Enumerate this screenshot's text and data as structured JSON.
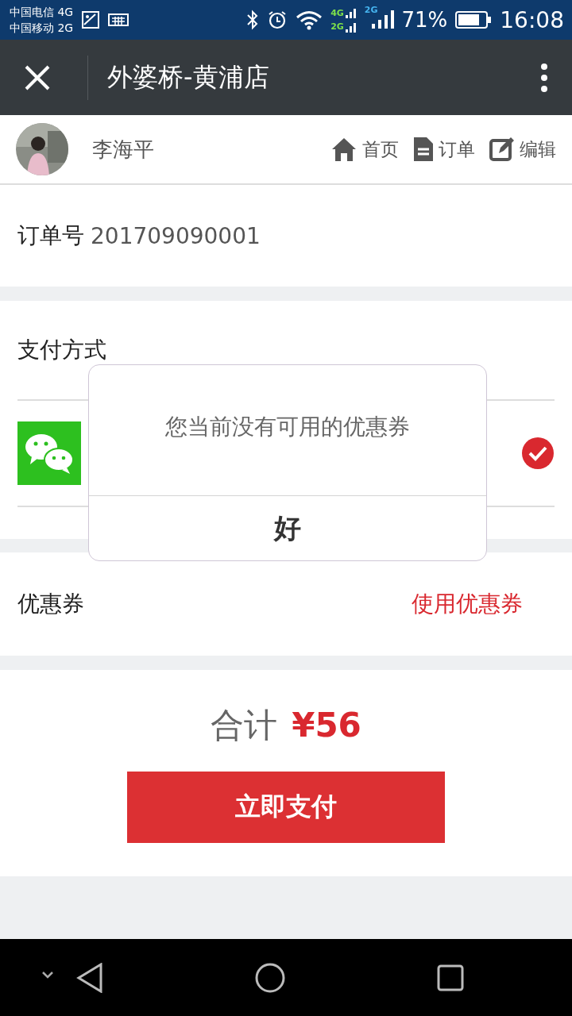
{
  "status_bar": {
    "carriers": [
      "中国电信 4G",
      "中国移动 2G"
    ],
    "sim_labels": [
      "4G",
      "2G"
    ],
    "signal_label": "2G",
    "battery": "71%",
    "time": "16:08"
  },
  "header": {
    "title": "外婆桥-黄浦店"
  },
  "user": {
    "name": "李海平",
    "links": [
      {
        "label": "首页",
        "kind": "home"
      },
      {
        "label": "订单",
        "kind": "document"
      },
      {
        "label": "编辑",
        "kind": "edit"
      }
    ]
  },
  "order": {
    "label": "订单号",
    "number": "201709090001"
  },
  "payment": {
    "title": "支付方式",
    "methods": [
      {
        "selected": true
      }
    ]
  },
  "coupon": {
    "label": "优惠券",
    "link": "使用优惠券"
  },
  "total": {
    "label": "合计",
    "amount": "¥56"
  },
  "pay_button": "立即支付",
  "dialog": {
    "message": "您当前没有可用的优惠券",
    "button": "好"
  }
}
